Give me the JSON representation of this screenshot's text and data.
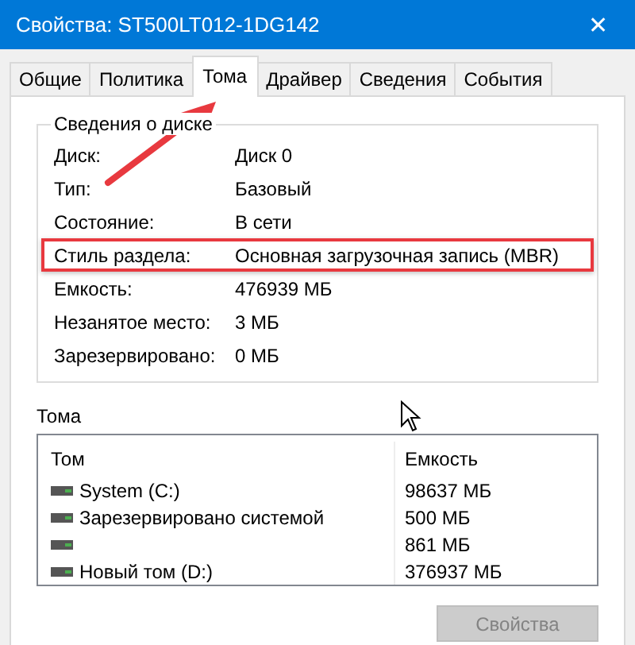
{
  "window": {
    "title": "Свойства: ST500LT012-1DG142",
    "close": "✕"
  },
  "tabs": [
    {
      "label": "Общие",
      "selected": false
    },
    {
      "label": "Политика",
      "selected": false
    },
    {
      "label": "Тома",
      "selected": true
    },
    {
      "label": "Драйвер",
      "selected": false
    },
    {
      "label": "Сведения",
      "selected": false
    },
    {
      "label": "События",
      "selected": false
    }
  ],
  "disk_group": {
    "title": "Сведения о диске",
    "rows": [
      {
        "label": "Диск:",
        "value": "Диск 0",
        "highlighted": false
      },
      {
        "label": "Тип:",
        "value": "Базовый",
        "highlighted": false
      },
      {
        "label": "Состояние:",
        "value": "В сети",
        "highlighted": false
      },
      {
        "label": "Стиль раздела:",
        "value": "Основная загрузочная запись (MBR)",
        "highlighted": true
      },
      {
        "label": "Емкость:",
        "value": "476939 МБ",
        "highlighted": false
      },
      {
        "label": "Незанятое место:",
        "value": "3 МБ",
        "highlighted": false
      },
      {
        "label": "Зарезервировано:",
        "value": "0 МБ",
        "highlighted": false
      }
    ]
  },
  "volumes": {
    "title": "Тома",
    "columns": [
      "Том",
      "Емкость"
    ],
    "rows": [
      {
        "name": "System (C:)",
        "capacity": "98637 МБ"
      },
      {
        "name": "Зарезервировано системой",
        "capacity": "500 МБ"
      },
      {
        "name": "",
        "capacity": "861 МБ"
      },
      {
        "name": "Новый том (D:)",
        "capacity": "376937 МБ"
      }
    ]
  },
  "buttons": [
    {
      "label": "Свойства",
      "disabled": true
    }
  ]
}
